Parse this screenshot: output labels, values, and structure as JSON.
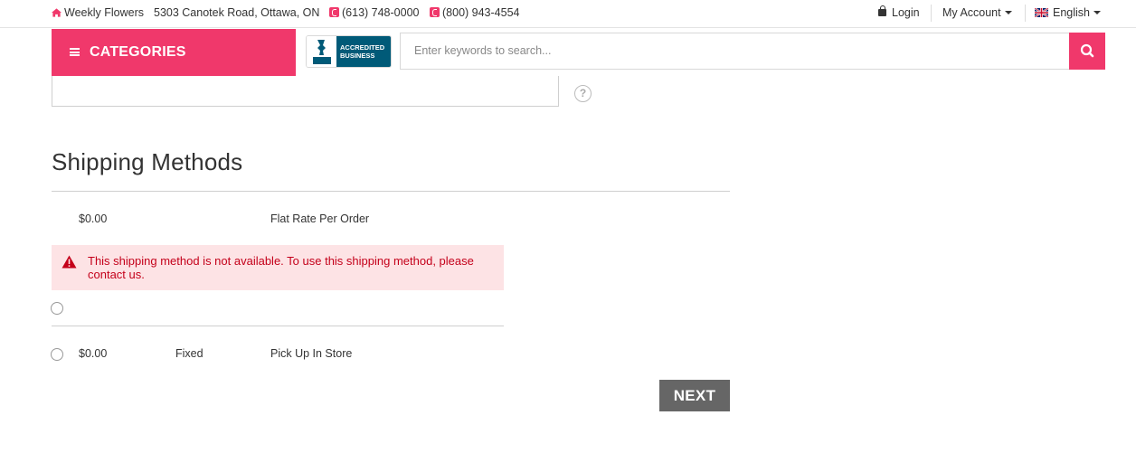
{
  "topbar": {
    "store_name": "Weekly Flowers",
    "address": "5303 Canotek Road, Ottawa, ON",
    "phone1": "(613) 748-0000",
    "phone2": "(800) 943-4554",
    "login_label": "Login",
    "account_label": "My Account",
    "language_label": "English"
  },
  "header": {
    "categories_label": "CATEGORIES",
    "bbb_line1": "ACCREDITED",
    "bbb_line2": "BUSINESS",
    "search_placeholder": "Enter keywords to search..."
  },
  "shipping": {
    "title": "Shipping Methods",
    "flat_rate": {
      "price": "$0.00",
      "name": "Flat Rate Per Order"
    },
    "alert_message": "This shipping method is not available. To use this shipping method, please contact us.",
    "pickup": {
      "price": "$0.00",
      "type": "Fixed",
      "name": "Pick Up In Store"
    },
    "next_label": "NEXT"
  },
  "colors": {
    "accent": "#f0386b",
    "alert_bg": "#fde3e5",
    "alert_text": "#c4001a",
    "button_gray": "#666666",
    "bbb_blue": "#005a78"
  },
  "icons": [
    "home-icon",
    "phone-icon",
    "lock-icon",
    "caret-down-icon",
    "uk-flag-icon",
    "menu-icon",
    "search-icon",
    "help-icon",
    "warning-icon"
  ]
}
